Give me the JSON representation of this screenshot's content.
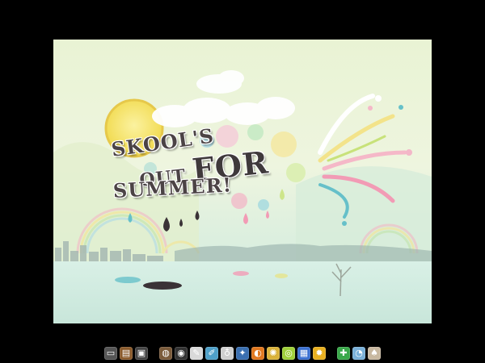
{
  "wallpaper": {
    "title_lines": [
      "SKOOL'S",
      "OUT",
      "FOR",
      "SUMMER!"
    ],
    "colors": {
      "background": "#e9f3d4",
      "sun": "#f3e36a",
      "water": "#d3ece4",
      "title_text": "#4b4345",
      "accent_pink": "#f29bb5",
      "accent_teal": "#66c0c9"
    }
  },
  "dock": {
    "groups": [
      [
        {
          "name": "monitor-icon",
          "glyph": "▭",
          "color": "#555555"
        },
        {
          "name": "book-icon",
          "glyph": "▤",
          "color": "#8a5a2b"
        },
        {
          "name": "terminal-icon",
          "glyph": "▣",
          "color": "#444444"
        }
      ],
      [
        {
          "name": "globe-icon",
          "glyph": "◍",
          "color": "#7a5a3a"
        },
        {
          "name": "disc-icon",
          "glyph": "◉",
          "color": "#333333"
        },
        {
          "name": "document-icon",
          "glyph": "✎",
          "color": "#d9d9d9"
        },
        {
          "name": "text-editor-icon",
          "glyph": "✐",
          "color": "#4fa0c8"
        },
        {
          "name": "bottle-icon",
          "glyph": "♁",
          "color": "#cfcfcf"
        },
        {
          "name": "paint-icon",
          "glyph": "✦",
          "color": "#3a6fb0"
        },
        {
          "name": "firefox-icon",
          "glyph": "◐",
          "color": "#e07820"
        },
        {
          "name": "bee-icon",
          "glyph": "✺",
          "color": "#d9b23a"
        },
        {
          "name": "tennis-ball-icon",
          "glyph": "◎",
          "color": "#9fcf3a"
        },
        {
          "name": "calendar-icon",
          "glyph": "▦",
          "color": "#3a6fd0"
        },
        {
          "name": "sun-icon",
          "glyph": "✹",
          "color": "#e8b020"
        }
      ],
      [
        {
          "name": "puzzle-icon",
          "glyph": "✚",
          "color": "#3aa84a"
        },
        {
          "name": "bird-icon",
          "glyph": "◔",
          "color": "#7ab0d8"
        },
        {
          "name": "mushroom-icon",
          "glyph": "♠",
          "color": "#c8b8a0"
        }
      ]
    ]
  }
}
